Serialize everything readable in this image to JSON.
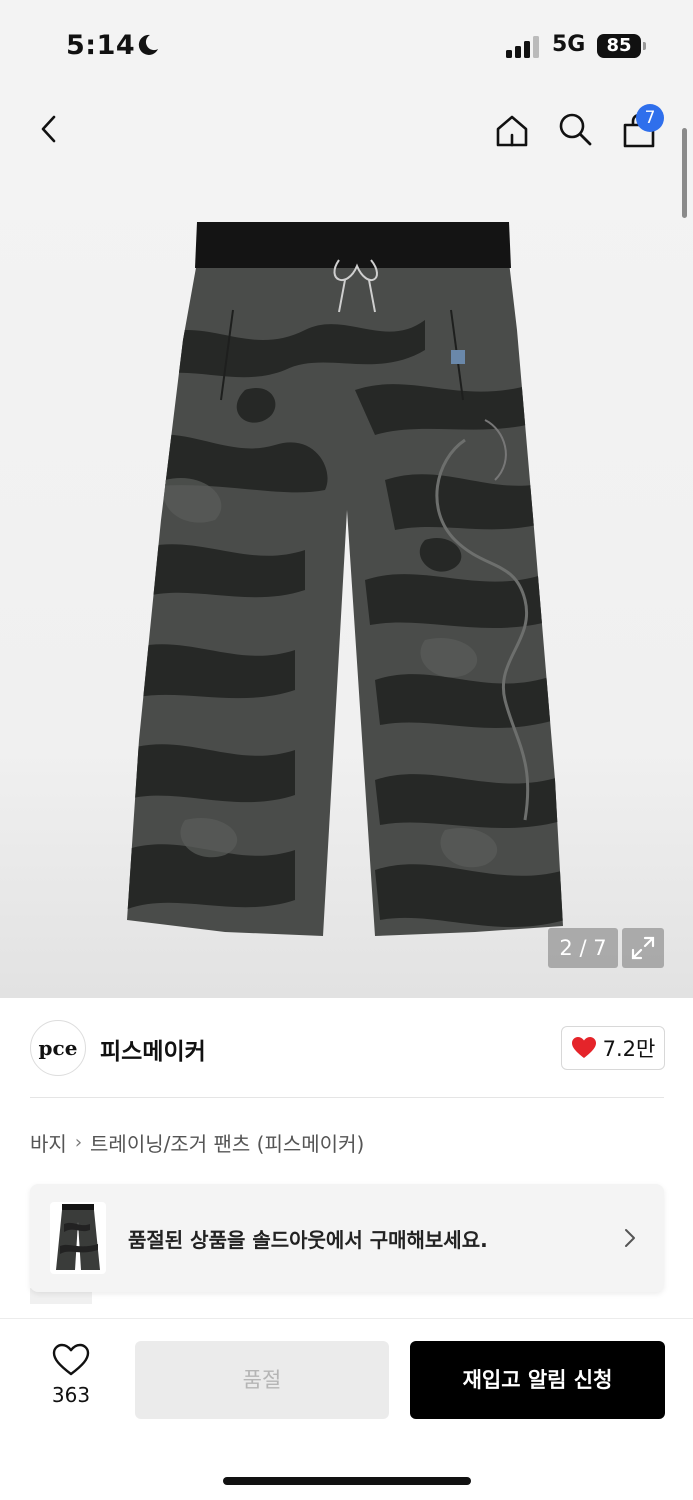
{
  "status_bar": {
    "time": "5:14",
    "network": "5G",
    "battery": "85"
  },
  "nav": {
    "cart_count": "7",
    "icons": [
      "back-icon",
      "home-icon",
      "search-icon",
      "shopping-bag-icon"
    ]
  },
  "gallery": {
    "counter": "2 / 7",
    "colors": {
      "fabric_dark": "#2b2d2b",
      "fabric_mid": "#4a4c4a",
      "waistband": "#141414"
    }
  },
  "brand": {
    "logo_text": "pce",
    "name": "피스메이커",
    "likes": "7.2만"
  },
  "breadcrumb": {
    "level1": "바지",
    "level2": "트레이닝/조거 팬츠 (피스메이커)"
  },
  "banner": {
    "text": "품절된 상품을 솔드아웃에서 구매해보세요."
  },
  "actions": {
    "wish_count": "363",
    "soldout_label": "품절",
    "restock_label": "재입고 알림 신청"
  },
  "colors": {
    "accent_blue": "#2f6fec",
    "heart_red": "#e5242a",
    "primary_button": "#000000"
  }
}
